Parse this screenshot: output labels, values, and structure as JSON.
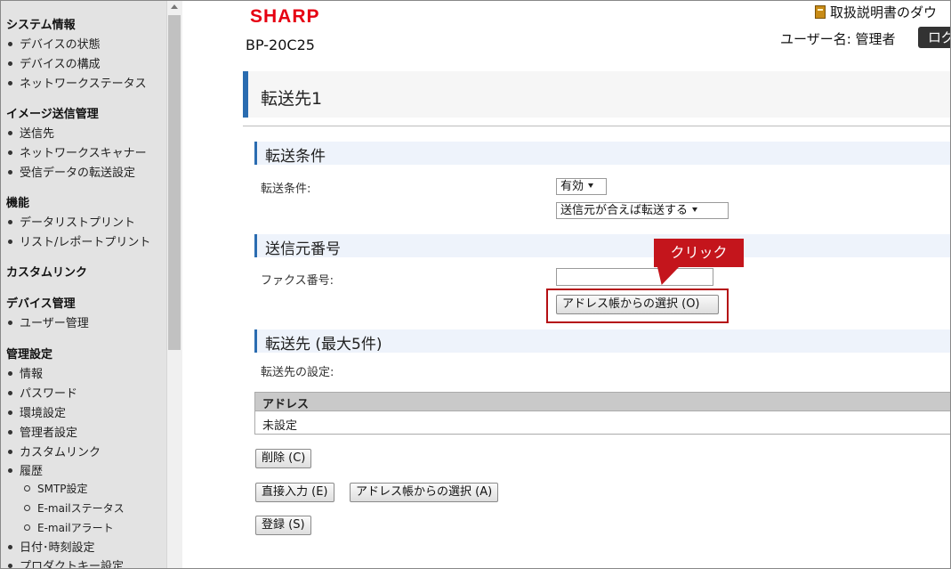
{
  "sidebar": {
    "sections": [
      {
        "title": "システム情報",
        "items": [
          "デバイスの状態",
          "デバイスの構成",
          "ネットワークステータス"
        ]
      },
      {
        "title": "イメージ送信管理",
        "items": [
          "送信先",
          "ネットワークスキャナー",
          "受信データの転送設定"
        ]
      },
      {
        "title": "機能",
        "items": [
          "データリストプリント",
          "リスト/レポートプリント"
        ]
      },
      {
        "title": "カスタムリンク",
        "items": []
      },
      {
        "title": "デバイス管理",
        "items": [
          "ユーザー管理"
        ]
      },
      {
        "title": "管理設定",
        "items": [
          "情報",
          "パスワード",
          "環境設定",
          "管理者設定",
          "カスタムリンク",
          "履歴"
        ],
        "sub_items": [
          "SMTP設定",
          "E-mailステータス",
          "E-mailアラート"
        ],
        "items_after": [
          "日付･時刻設定",
          "プロダクトキー設定"
        ]
      }
    ]
  },
  "header": {
    "logo": "SHARP",
    "model": "BP-20C25",
    "manual_link": "取扱説明書のダウ",
    "user_label": "ユーザー名: 管理者",
    "logout_label": "ログ"
  },
  "page": {
    "title": "転送先1",
    "sections": {
      "condition": {
        "heading": "転送条件",
        "label": "転送条件:",
        "select1": "有効",
        "select2": "送信元が合えば転送する"
      },
      "source": {
        "heading": "送信元番号",
        "fax_label": "ファクス番号:",
        "fax_value": "",
        "addr_button": "アドレス帳からの選択 (O)",
        "callout": "クリック"
      },
      "destination": {
        "heading": "転送先 (最大5件)",
        "label": "転送先の設定:",
        "table_header": "アドレス",
        "table_row": "未設定"
      }
    },
    "buttons": {
      "delete": "削除 (C)",
      "direct_input": "直接入力 (E)",
      "addr_select": "アドレス帳からの選択 (A)",
      "register": "登録 (S)"
    }
  },
  "colors": {
    "accent": "#2a6cb0",
    "brand": "#e60012",
    "callout": "#c4151c"
  }
}
